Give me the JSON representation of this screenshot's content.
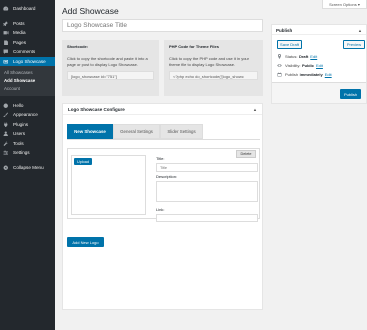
{
  "screen_options": "Screen Options ▾",
  "sidebar": {
    "items_top": [
      {
        "label": "Dashboard",
        "icon": "dashboard-icon"
      },
      {
        "label": "Posts",
        "icon": "pin-icon"
      },
      {
        "label": "Media",
        "icon": "media-icon"
      },
      {
        "label": "Pages",
        "icon": "pages-icon"
      },
      {
        "label": "Comments",
        "icon": "comments-icon"
      },
      {
        "label": "Logo Showcase",
        "icon": "logo-showcase-icon"
      }
    ],
    "submenu": [
      "All Showcases",
      "Add Showcase",
      "Account"
    ],
    "items_bottom": [
      {
        "label": "Hello",
        "icon": "hello-icon"
      },
      {
        "label": "Appearance",
        "icon": "appearance-icon"
      },
      {
        "label": "Plugins",
        "icon": "plugins-icon"
      },
      {
        "label": "Users",
        "icon": "users-icon"
      },
      {
        "label": "Tools",
        "icon": "tools-icon"
      },
      {
        "label": "Settings",
        "icon": "settings-icon"
      }
    ],
    "collapse": "Collapse Menu"
  },
  "page": {
    "title": "Add Showcase",
    "title_placeholder": "Logo Showcase Title"
  },
  "shortcode": {
    "label": "Shortcode:",
    "desc": "Click to copy the shortcode and paste it into a page or post to display Logo Showcase.",
    "code": "[logo_showcase id=\"751\"]"
  },
  "php_code": {
    "label": "PHP Code for Theme Files",
    "desc": "Click to copy the PHP code and use it in your theme file to display Logo Showcase.",
    "code": "<?php echo do_shortcode('[logo_showc"
  },
  "configure": {
    "title": "Logo Showcase Configure",
    "arrow": "▲",
    "tabs": [
      "New Showcase",
      "General Settings",
      "Slider Settings"
    ],
    "upload_label": "Upload",
    "delete_label": "Delete",
    "title_label": "Title:",
    "title_placeholder": "Title",
    "description_label": "Description:",
    "link_label": "Link:",
    "add_new_label": "Add New Logo"
  },
  "publish": {
    "title": "Publish",
    "arrow": "▲",
    "save_draft": "Save Draft",
    "preview": "Preview",
    "status_label": "Status:",
    "status_value": "Draft",
    "visibility_label": "Visibility:",
    "visibility_value": "Public",
    "publish_label": "Publish",
    "publish_value": "immediately",
    "edit_label": "Edit",
    "publish_button": "Publish"
  },
  "colors": {
    "accent": "#0073aa",
    "sidebar_bg": "#23282d",
    "background": "#f1f1f1"
  }
}
